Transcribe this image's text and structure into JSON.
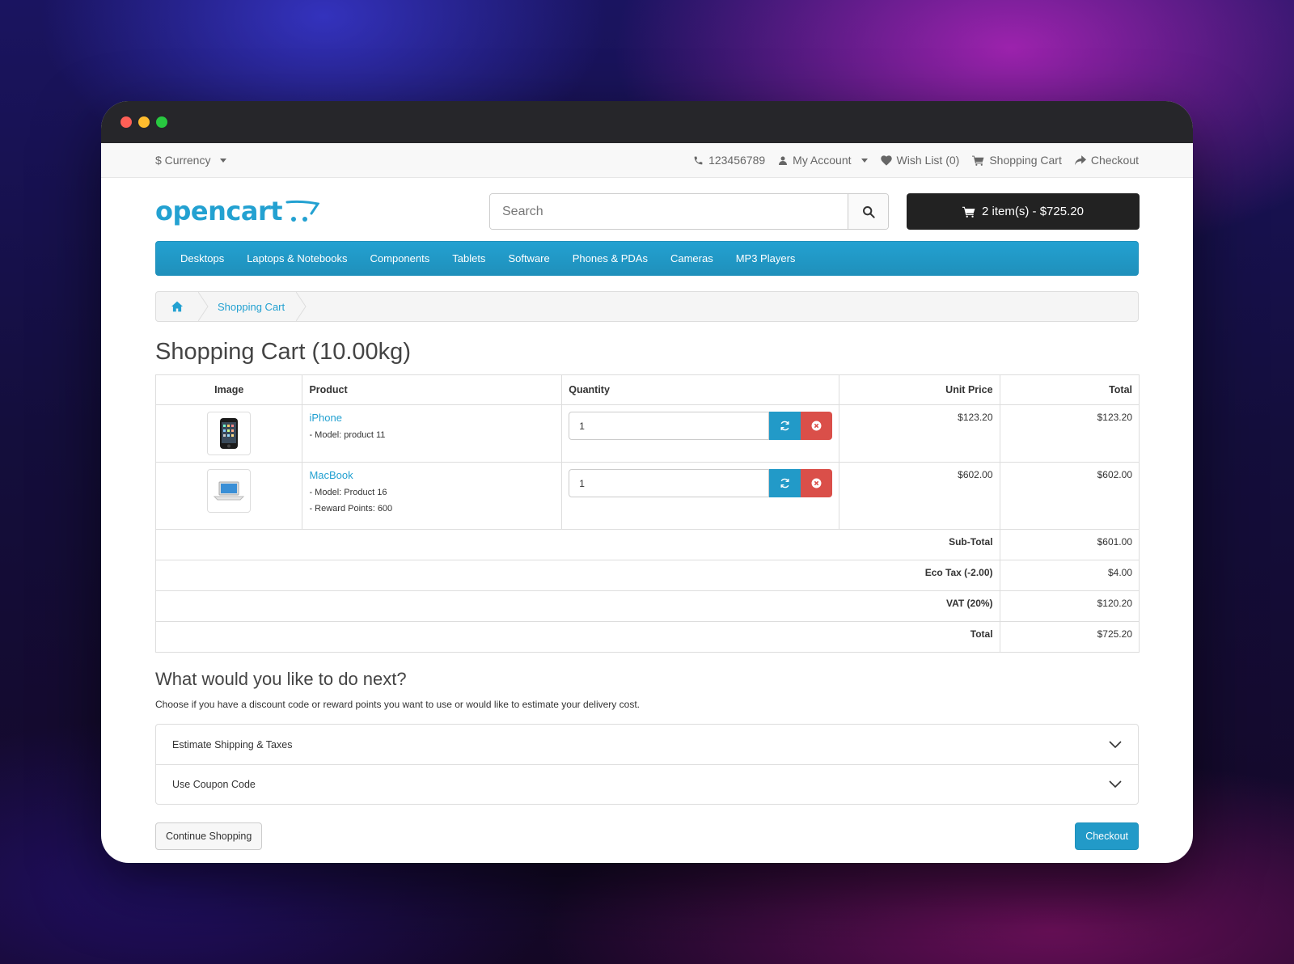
{
  "topbar": {
    "currency_label": "$ Currency",
    "phone": "123456789",
    "my_account": "My Account",
    "wish_list": "Wish List (0)",
    "shopping_cart": "Shopping Cart",
    "checkout": "Checkout"
  },
  "header": {
    "logo_text": "opencart",
    "search_placeholder": "Search",
    "cart_summary": "2 item(s) - $725.20"
  },
  "menu": {
    "items": [
      "Desktops",
      "Laptops & Notebooks",
      "Components",
      "Tablets",
      "Software",
      "Phones & PDAs",
      "Cameras",
      "MP3 Players"
    ]
  },
  "breadcrumb": {
    "current": "Shopping Cart"
  },
  "page": {
    "title": "Shopping Cart (10.00kg)"
  },
  "cart_table": {
    "headers": {
      "image": "Image",
      "product": "Product",
      "quantity": "Quantity",
      "unit_price": "Unit Price",
      "total": "Total"
    },
    "rows": [
      {
        "name": "iPhone",
        "details": [
          "- Model: product 11"
        ],
        "quantity": "1",
        "unit_price": "$123.20",
        "total": "$123.20"
      },
      {
        "name": "MacBook",
        "details": [
          "- Model: Product 16",
          "- Reward Points: 600"
        ],
        "quantity": "1",
        "unit_price": "$602.00",
        "total": "$602.00"
      }
    ],
    "totals": [
      {
        "label": "Sub-Total",
        "value": "$601.00"
      },
      {
        "label": "Eco Tax (-2.00)",
        "value": "$4.00"
      },
      {
        "label": "VAT (20%)",
        "value": "$120.20"
      },
      {
        "label": "Total",
        "value": "$725.20"
      }
    ]
  },
  "next": {
    "heading": "What would you like to do next?",
    "intro": "Choose if you have a discount code or reward points you want to use or would like to estimate your delivery cost.",
    "accordion": [
      "Estimate Shipping & Taxes",
      "Use Coupon Code"
    ]
  },
  "buttons": {
    "continue": "Continue Shopping",
    "checkout": "Checkout"
  },
  "colors": {
    "accent": "#23a1d1",
    "danger": "#da4f49",
    "dark": "#222222"
  }
}
